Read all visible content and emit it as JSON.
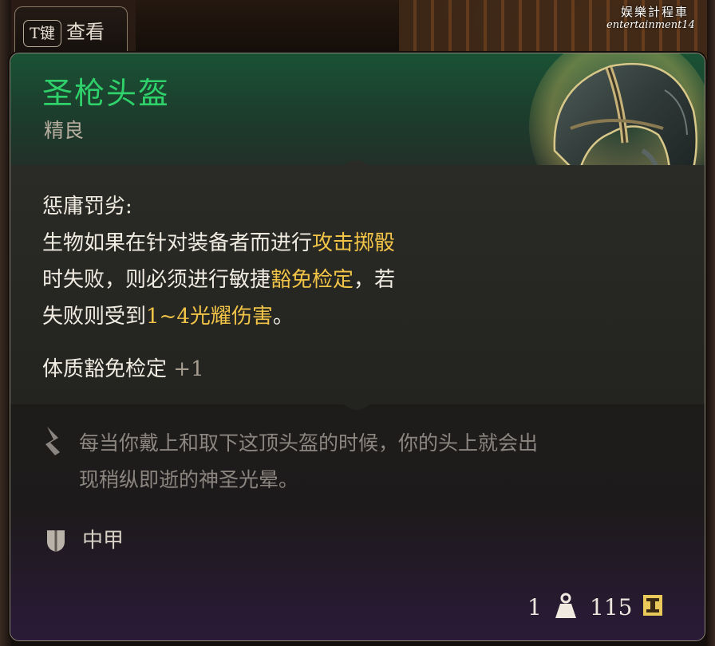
{
  "prompt": {
    "key": "T键",
    "label": "查看"
  },
  "watermark": {
    "name": "娱樂計程車",
    "handle": "entertainment14"
  },
  "item": {
    "name": "圣枪头盔",
    "rarity": "精良",
    "ability": {
      "title": "惩庸罚劣:",
      "line1_a": "生物如果在针对装备者而进行",
      "line1_b": "攻击掷骰",
      "line2_a": "时失败，则必须进行敏捷",
      "line2_b": "豁免检定",
      "line2_c": "，若",
      "line3_a": "失败则受到",
      "line3_b": "1~4光耀伤害",
      "line3_c": "。"
    },
    "stat": {
      "name": "体质豁免检定",
      "bonus": "+1"
    },
    "flavor": {
      "line1": "每当你戴上和取下这顶头盔的时候，你的头上就会出",
      "line2": "现稍纵即逝的神圣光晕。"
    },
    "armor_type": "中甲",
    "weight": "1",
    "value": "115"
  },
  "colors": {
    "name": "#2fd16a",
    "highlight": "#f1c447",
    "header_bg": "#1a5235",
    "footer_tint": "#2a1a38"
  },
  "icons": [
    "helmet-image",
    "feather-icon",
    "shield-icon",
    "weight-icon",
    "gold-coin-icon"
  ]
}
